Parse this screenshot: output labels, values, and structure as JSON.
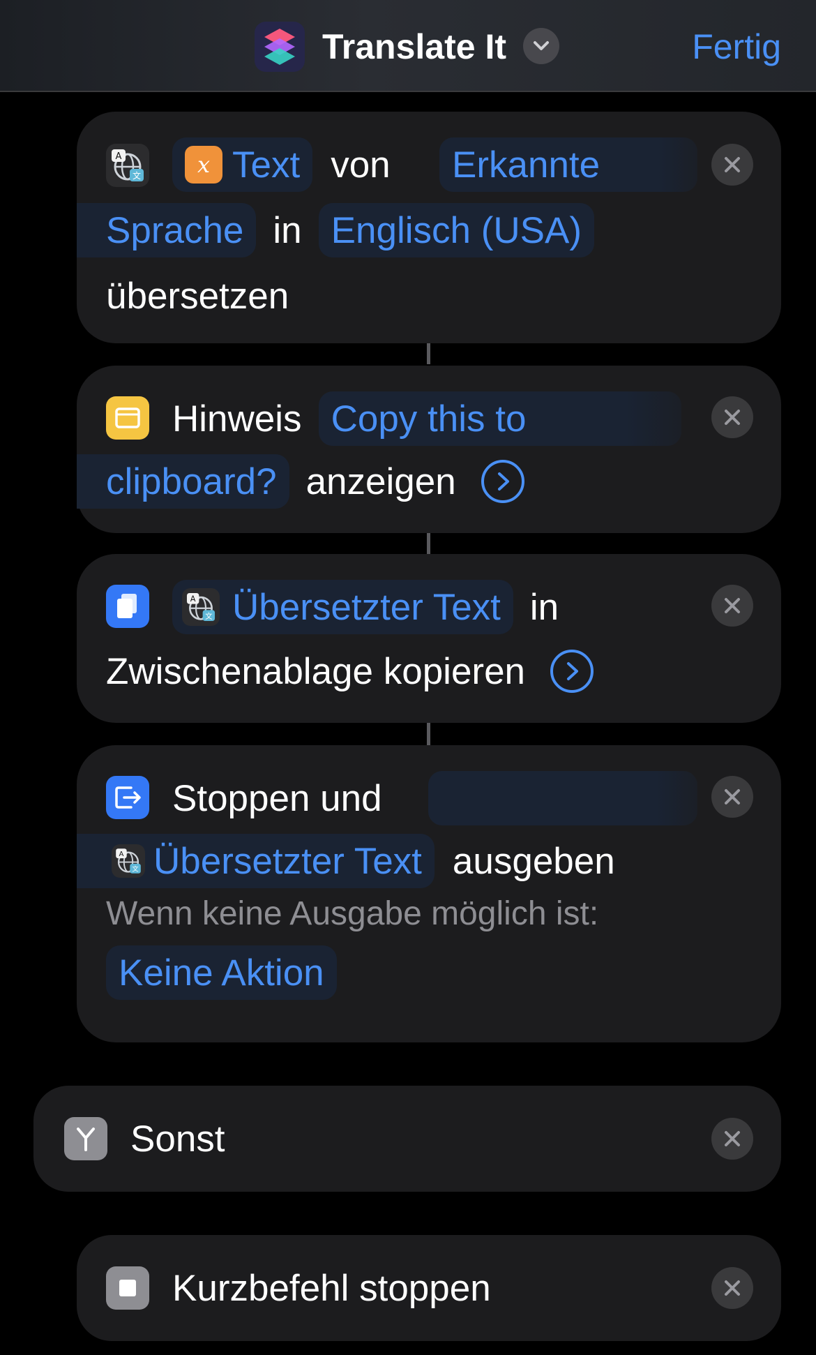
{
  "header": {
    "title": "Translate It",
    "done_label": "Fertig",
    "app_icon": "shortcuts-icon",
    "menu_icon": "chevron-down-icon"
  },
  "actions": [
    {
      "icon": "translate-icon",
      "token_text_label": "Text",
      "word_von": "von",
      "token_source_part1": "Erkannte",
      "token_source_part2": "Sprache",
      "word_in": "in",
      "token_target": "Englisch (USA)",
      "word_translate": "übersetzen"
    },
    {
      "icon": "alert-icon",
      "word_hint": "Hinweis",
      "token_message_part1": "Copy this to",
      "token_message_part2": "clipboard?",
      "word_show": "anzeigen"
    },
    {
      "icon": "clipboard-icon",
      "token_translated": "Übersetzter Text",
      "word_in": "in",
      "word_copy": "Zwischenablage kopieren"
    },
    {
      "icon": "output-icon",
      "word_stop_and": "Stoppen und",
      "token_translated": "Übersetzter Text",
      "word_output": "ausgeben",
      "fallback_label": "Wenn keine Ausgabe möglich ist:",
      "fallback_value": "Keine Aktion"
    }
  ],
  "otherwise": {
    "icon": "branch-icon",
    "label": "Sonst"
  },
  "stop_shortcut": {
    "icon": "stop-icon",
    "label": "Kurzbefehl stoppen"
  },
  "colors": {
    "accent": "#4a90f5",
    "card": "#1c1c1e",
    "token_bg": "#1a2333",
    "variable_orange": "#f0923a",
    "alert_yellow": "#f5c542",
    "clipboard_blue": "#3478f6"
  }
}
